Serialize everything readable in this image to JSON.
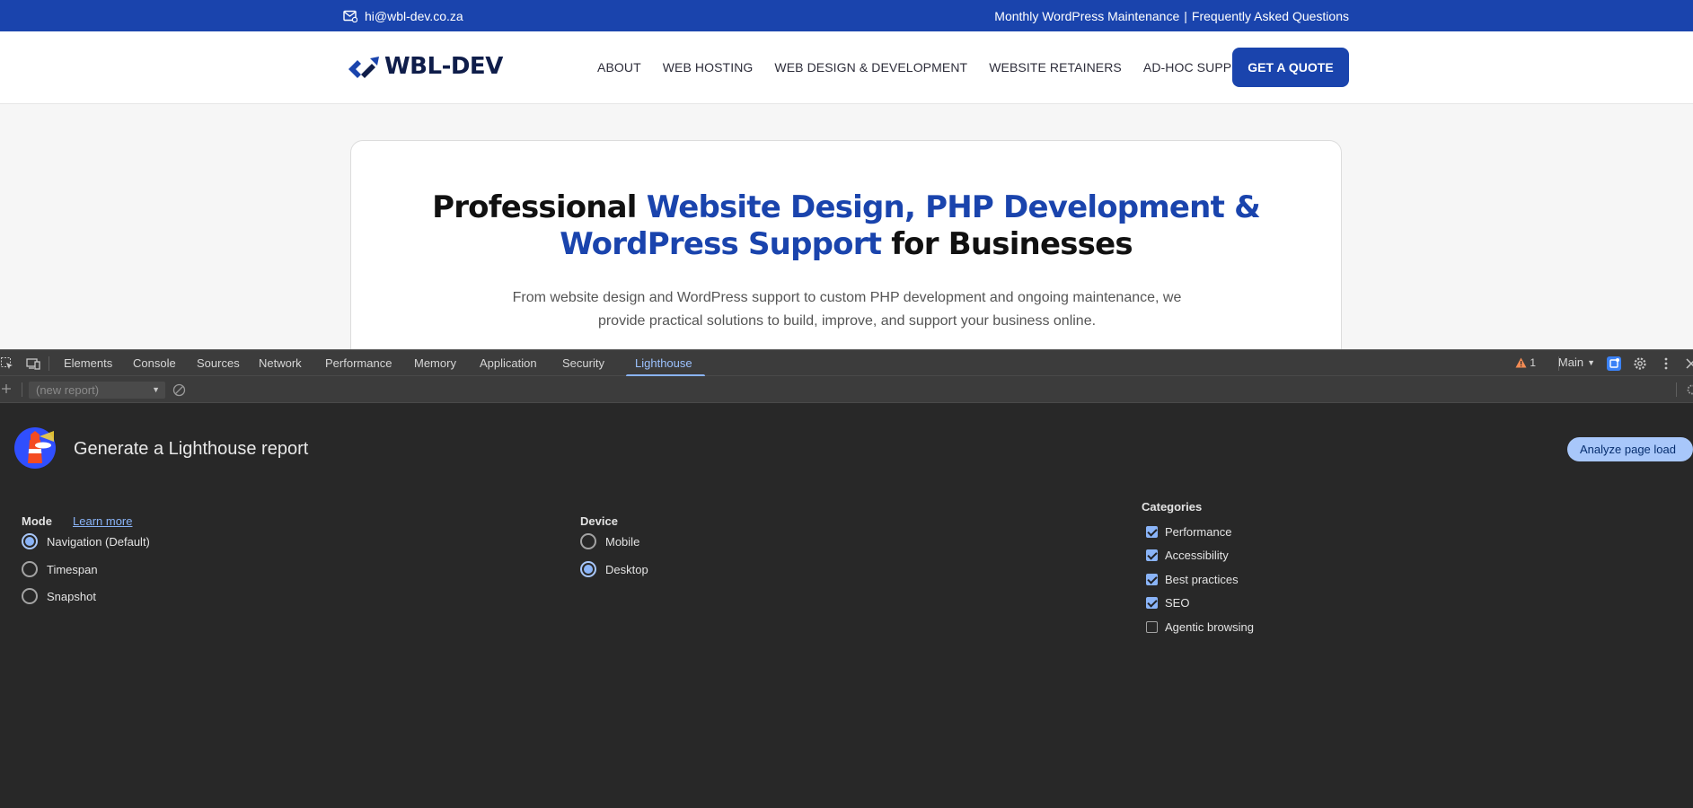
{
  "site": {
    "topbar": {
      "email": "hi@wbl-dev.co.za",
      "link_maintenance": "Monthly WordPress Maintenance",
      "separator": "|",
      "link_faq": "Frequently Asked Questions",
      "bg_color": "#1a44ad"
    },
    "logo": {
      "text": "WBL-DEV"
    },
    "nav": {
      "items": [
        "ABOUT",
        "WEB HOSTING",
        "WEB DESIGN & DEVELOPMENT",
        "WEBSITE RETAINERS",
        "AD-HOC SUPPORT"
      ],
      "cta": "GET A QUOTE"
    },
    "hero": {
      "title_part1": "Professional ",
      "title_part2": "Website Design, PHP Development &",
      "title_part3": "WordPress Support",
      "title_part4": " for Businesses",
      "subtitle": "From website design and WordPress support to custom PHP development and ongoing maintenance, we provide practical solutions to build, improve, and support your business online.",
      "accent_color": "#1a44ad"
    }
  },
  "devtools": {
    "tabs": [
      "Elements",
      "Console",
      "Sources",
      "Network",
      "Performance",
      "Memory",
      "Application",
      "Security",
      "Lighthouse"
    ],
    "active_tab": "Lighthouse",
    "warning_count": "1",
    "context": "Main",
    "report_select": "(new report)",
    "lighthouse": {
      "heading": "Generate a Lighthouse report",
      "analyze_button": "Analyze page load",
      "mode": {
        "label": "Mode",
        "learn_more": "Learn more",
        "options": [
          {
            "label": "Navigation (Default)",
            "checked": true
          },
          {
            "label": "Timespan",
            "checked": false
          },
          {
            "label": "Snapshot",
            "checked": false
          }
        ]
      },
      "device": {
        "label": "Device",
        "options": [
          {
            "label": "Mobile",
            "checked": false
          },
          {
            "label": "Desktop",
            "checked": true
          }
        ]
      },
      "categories": {
        "label": "Categories",
        "options": [
          {
            "label": "Performance",
            "checked": true
          },
          {
            "label": "Accessibility",
            "checked": true
          },
          {
            "label": "Best practices",
            "checked": true
          },
          {
            "label": "SEO",
            "checked": true
          },
          {
            "label": "Agentic browsing",
            "checked": false
          }
        ]
      }
    }
  }
}
